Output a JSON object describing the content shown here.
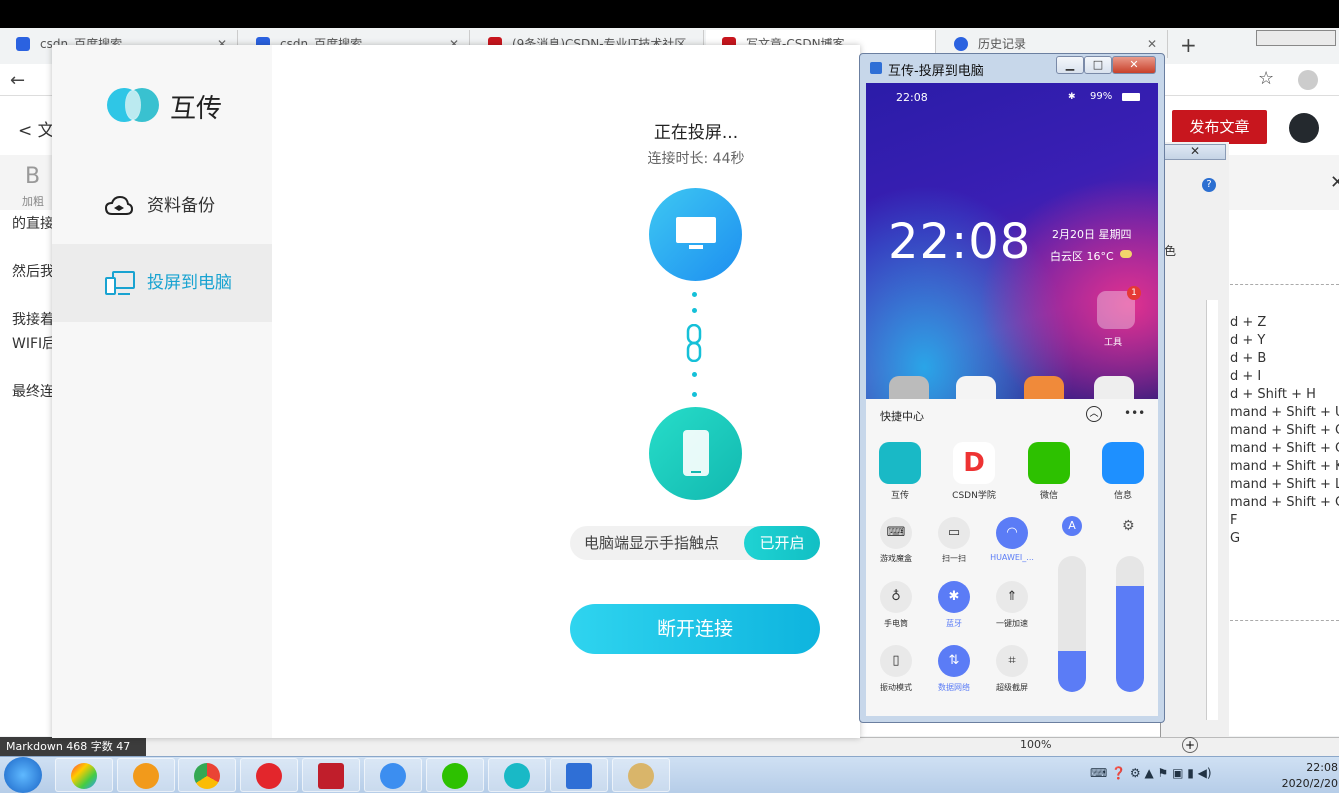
{
  "browser": {
    "tabs": [
      {
        "label": "csdn_百度搜索"
      },
      {
        "label": "csdn_百度搜索"
      },
      {
        "label": "(9条消息)CSDN-专业IT技术社区"
      },
      {
        "label": "写文章-CSDN博客"
      },
      {
        "label": "历史记录"
      }
    ],
    "new_tab": "+",
    "back": "←",
    "forward": "→",
    "star": "☆"
  },
  "csdn": {
    "back_label": "< 文",
    "bold_letter": "B",
    "bold_label": "加粗",
    "publish": "发布文章",
    "editor_lines": [
      "的直接",
      "然后我",
      "我接着",
      "WIFI后",
      "最终连"
    ],
    "shortcuts": [
      "d + Z",
      "d + Y",
      "d + B",
      "d + I",
      "d + Shift + H",
      "mand + Shift + U",
      "mand + Shift + O",
      "mand + Shift + C",
      "mand + Shift + K",
      "mand + Shift + L",
      "mand + Shift + G",
      "F",
      "G"
    ],
    "dialog_char": "色",
    "status_md": "Markdown  468 字数  47",
    "zoom": "100%"
  },
  "huchuan": {
    "app_name": "互传",
    "nav": [
      {
        "label": "资料备份"
      },
      {
        "label": "投屏到电脑"
      }
    ],
    "status": "正在投屏...",
    "duration": "连接时长: 44秒",
    "touch_label": "电脑端显示手指触点",
    "touch_state": "已开启",
    "disconnect": "断开连接"
  },
  "phone_window": {
    "title": "互传-投屏到电脑",
    "status_time": "22:08",
    "battery": "99%",
    "clock": "22:08",
    "date": "2月20日 星期四",
    "weather": "白云区 16°C",
    "folder_label": "工具",
    "folder_badge": "1",
    "qc_title": "快捷中心",
    "apps": [
      {
        "label": "互传",
        "color": "#19b9c6"
      },
      {
        "label": "CSDN学院",
        "color": "#ffffff"
      },
      {
        "label": "微信",
        "color": "#2dc100"
      },
      {
        "label": "信息",
        "color": "#1e90ff"
      }
    ],
    "toggles": [
      {
        "label": "游戏魔盒",
        "icon": "gamepad-icon",
        "on": false
      },
      {
        "label": "扫一扫",
        "icon": "scan-icon",
        "on": false
      },
      {
        "label": "HUAWEI_...",
        "icon": "wifi-icon",
        "on": true
      },
      {
        "label": "手电筒",
        "icon": "flashlight-icon",
        "on": false
      },
      {
        "label": "蓝牙",
        "icon": "bluetooth-icon",
        "on": true
      },
      {
        "label": "一键加速",
        "icon": "rocket-icon",
        "on": false
      },
      {
        "label": "振动模式",
        "icon": "vibrate-icon",
        "on": false
      },
      {
        "label": "数据网络",
        "icon": "data-icon",
        "on": true
      },
      {
        "label": "超级截屏",
        "icon": "crop-icon",
        "on": false
      }
    ],
    "brightness": 0.3,
    "volume": 0.78
  },
  "taskbar": {
    "time": "22:08",
    "date": "2020/2/20"
  }
}
